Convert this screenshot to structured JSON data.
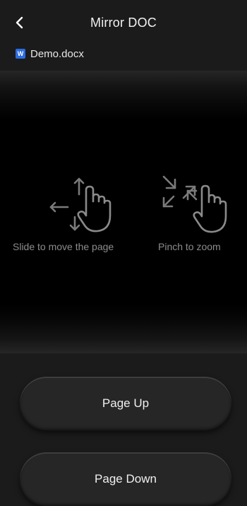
{
  "header": {
    "title": "Mirror DOC",
    "back_icon": "chevron-left-icon"
  },
  "file": {
    "icon_letter": "W",
    "name": "Demo.docx",
    "icon_color": "#2b6de0"
  },
  "gestures": {
    "slide_label": "Slide to move the page",
    "pinch_label": "Pinch to zoom"
  },
  "controls": {
    "page_up_label": "Page Up",
    "page_down_label": "Page Down"
  }
}
